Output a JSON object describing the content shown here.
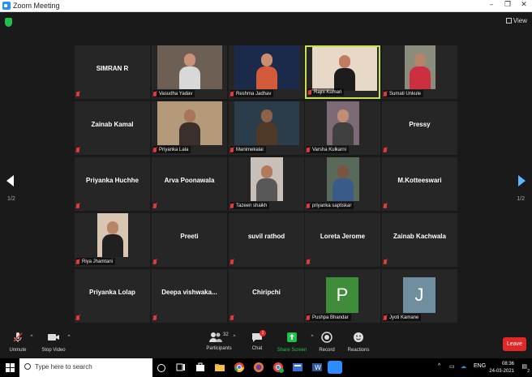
{
  "window": {
    "title": "Zoom Meeting",
    "controls": [
      "–",
      "❐",
      "✕"
    ]
  },
  "topbar": {
    "view_label": "View"
  },
  "paging": {
    "left": "1/2",
    "right": "1/2"
  },
  "tiles": [
    {
      "big": "SIMRAN R",
      "label": "",
      "video": false
    },
    {
      "big": "",
      "label": "Vasudha Yadav",
      "video": true,
      "bg": "#6d5f54",
      "skin": "#c89378",
      "shirt": "#d8d8d8"
    },
    {
      "big": "",
      "label": "Reshma Jadhav",
      "video": true,
      "bg": "#1b2a4a",
      "skin": "#c98f6e",
      "shirt": "#d35a3a"
    },
    {
      "big": "",
      "label": "Rajni Kumari",
      "video": true,
      "active": true,
      "bg": "#e8d8c8",
      "skin": "#c27d60",
      "shirt": "#1c1c1c"
    },
    {
      "big": "",
      "label": "Sumati Unkule",
      "video": true,
      "bg": "#8c8c7c",
      "skin": "#b9826a",
      "shirt": "#cc2f3f"
    },
    {
      "big": "Zainab Kamal",
      "label": "",
      "video": false
    },
    {
      "big": "",
      "label": "Priyanka Lala",
      "video": true,
      "bg": "#b49a7a",
      "skin": "#a8745a",
      "shirt": "#3a2f2a"
    },
    {
      "big": "",
      "label": "Manimekalai",
      "video": true,
      "bg": "#2b3d4a",
      "skin": "#8c6248",
      "shirt": "#4f3a2a"
    },
    {
      "big": "",
      "label": "Varsha Kulkarni",
      "video": true,
      "bg": "#7c6a76",
      "skin": "#c08e74",
      "shirt": "#404040"
    },
    {
      "big": "Pressy",
      "label": "",
      "video": false
    },
    {
      "big": "Priyanka Huchhe",
      "label": "",
      "video": false
    },
    {
      "big": "Arva Poonawala",
      "label": "",
      "video": false
    },
    {
      "big": "",
      "label": "Tazeen shaikh",
      "video": true,
      "bg": "#c8c0b8",
      "skin": "#b07a5c",
      "shirt": "#585858"
    },
    {
      "big": "",
      "label": "priyanka saptiskar",
      "video": true,
      "bg": "#5a6a5a",
      "skin": "#7a5440",
      "shirt": "#3a5a8a"
    },
    {
      "big": "M.Kotteeswari",
      "label": "",
      "video": false
    },
    {
      "big": "",
      "label": "Riya Jhamtani",
      "video": true,
      "bg": "#d9c6b2",
      "skin": "#b88568",
      "shirt": "#202020"
    },
    {
      "big": "Preeti",
      "label": "",
      "video": false
    },
    {
      "big": "suvil rathod",
      "label": "",
      "video": false
    },
    {
      "big": "Loreta Jerome",
      "label": "",
      "video": false
    },
    {
      "big": "Zainab Kachwala",
      "label": "",
      "video": false
    },
    {
      "big": "Priyanka Lolap",
      "label": "",
      "video": false
    },
    {
      "big": "Deepa  vishwaka...",
      "label": "",
      "video": false
    },
    {
      "big": "Chiripchi",
      "label": "",
      "video": false
    },
    {
      "big": "",
      "label": "Pushpa Bhandar",
      "avatar": "P",
      "avatar_color": "#3f8d3a"
    },
    {
      "big": "",
      "label": "Jyoti Kamane",
      "avatar": "J",
      "avatar_color": "#6f8ea0"
    }
  ],
  "toolbar": {
    "unmute": "Unmute",
    "stop_video": "Stop Video",
    "participants": "Participants",
    "participants_count": "32",
    "chat": "Chat",
    "chat_badge": "1",
    "share_screen": "Share Screen",
    "record": "Record",
    "reactions": "Reactions",
    "leave": "Leave"
  },
  "taskbar": {
    "search_placeholder": "Type here to search",
    "lang": "ENG",
    "time": "08:36",
    "date": "24-03-2021",
    "notification_badge": "2"
  },
  "colors": {
    "active_border": "#c6e14b",
    "leave": "#e02828",
    "share": "#21c04a",
    "accent": "#2d8cff"
  }
}
